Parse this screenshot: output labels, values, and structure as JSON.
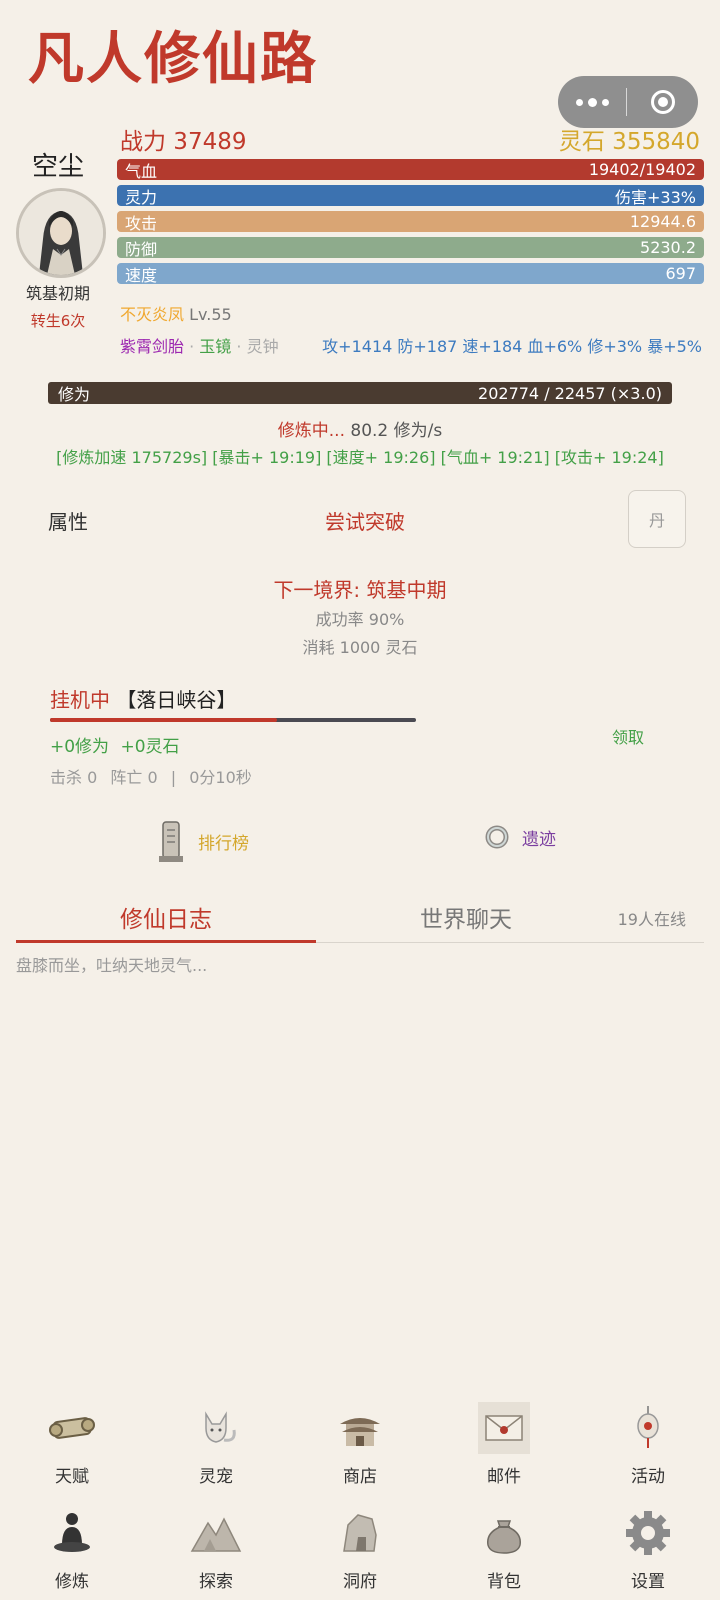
{
  "app": {
    "title": "凡人修仙路"
  },
  "player": {
    "name": "空尘",
    "realm": "筑基初期",
    "rebirth": "转生6次",
    "power": "战力 37489",
    "spirit_stone": "灵石 355840"
  },
  "stats": {
    "hp": {
      "label": "气血",
      "value": "19402/19402",
      "fill": 1.0
    },
    "mana": {
      "label": "灵力",
      "value": "伤害+33%"
    },
    "attack": {
      "label": "攻击",
      "value": "12944.6"
    },
    "defense": {
      "label": "防御",
      "value": "5230.2"
    },
    "speed": {
      "label": "速度",
      "value": "697"
    }
  },
  "treasure": {
    "name": "不灭炎凤",
    "level": "Lv.55"
  },
  "equipment": [
    {
      "name": "紫霄剑胎",
      "color": "#9c27b0"
    },
    {
      "name": "玉镜",
      "color": "#43a047"
    },
    {
      "name": "灵钟",
      "color": "#aaaaaa"
    }
  ],
  "equipment_sep": "·",
  "bonus": "攻+1414 防+187 速+184 血+6% 修+3% 暴+5%",
  "cultivation": {
    "label": "修为",
    "value": "202774 / 22457 (×3.0)",
    "status": "修炼中...",
    "rate": "80.2 修为/s",
    "buffs": "[修炼加速 175729s] [暴击+ 19:19] [速度+ 19:26] [气血+ 19:21] [攻击+ 19:24]"
  },
  "actions": {
    "attributes": "属性",
    "breakthrough": "尝试突破",
    "pill": "丹"
  },
  "next_realm": {
    "title": "下一境界: 筑基中期",
    "success_rate": "成功率 90%",
    "cost": "消耗 1000 灵石"
  },
  "idle": {
    "status": "挂机中",
    "location": "【落日峡谷】",
    "progress": 0.62,
    "gain_cultivation": "+0修为",
    "gain_stone": "+0灵石",
    "claim": "领取",
    "kills": "击杀 0",
    "deaths": "阵亡 0",
    "sep": "|",
    "time": "0分10秒"
  },
  "links": {
    "ranking": "排行榜",
    "ruins": "遗迹"
  },
  "tabs": {
    "log": "修仙日志",
    "chat": "世界聊天",
    "online": "19人在线"
  },
  "log_lines": [
    "盘膝而坐，吐纳天地灵气..."
  ],
  "nav_top": [
    {
      "label": "天赋",
      "icon": "scroll-icon"
    },
    {
      "label": "灵宠",
      "icon": "fox-icon"
    },
    {
      "label": "商店",
      "icon": "pavilion-icon"
    },
    {
      "label": "邮件",
      "icon": "envelope-icon"
    },
    {
      "label": "活动",
      "icon": "lantern-icon"
    }
  ],
  "nav_bottom": [
    {
      "label": "修炼",
      "icon": "meditation-icon"
    },
    {
      "label": "探索",
      "icon": "mountain-icon"
    },
    {
      "label": "洞府",
      "icon": "rock-icon"
    },
    {
      "label": "背包",
      "icon": "bag-icon"
    },
    {
      "label": "设置",
      "icon": "gear-icon"
    }
  ],
  "colors": {
    "accent": "#c0392b",
    "gold": "#d4a72c",
    "green": "#43a047",
    "blue": "#3d7bc0"
  }
}
